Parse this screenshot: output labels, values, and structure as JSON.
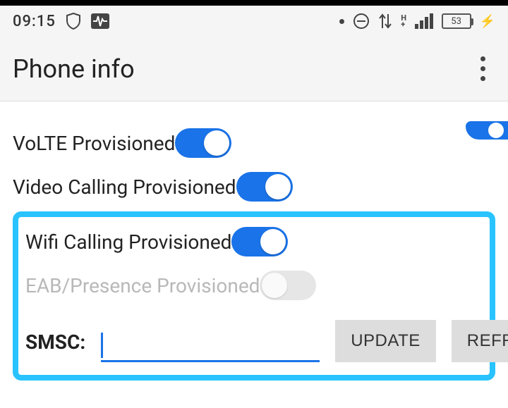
{
  "status": {
    "time": "09:15",
    "battery": "53"
  },
  "appbar": {
    "title": "Phone info"
  },
  "toggles": {
    "volte": {
      "label": "VoLTE Provisioned",
      "on": true
    },
    "video": {
      "label": "Video Calling Provisioned",
      "on": true
    },
    "wifi": {
      "label": "Wifi Calling Provisioned",
      "on": true
    },
    "eab": {
      "label": "EAB/Presence Provisioned",
      "on": false
    }
  },
  "smsc": {
    "label": "SMSC:",
    "value": "",
    "update_btn": "UPDATE",
    "refresh_btn": "REFRESH"
  }
}
